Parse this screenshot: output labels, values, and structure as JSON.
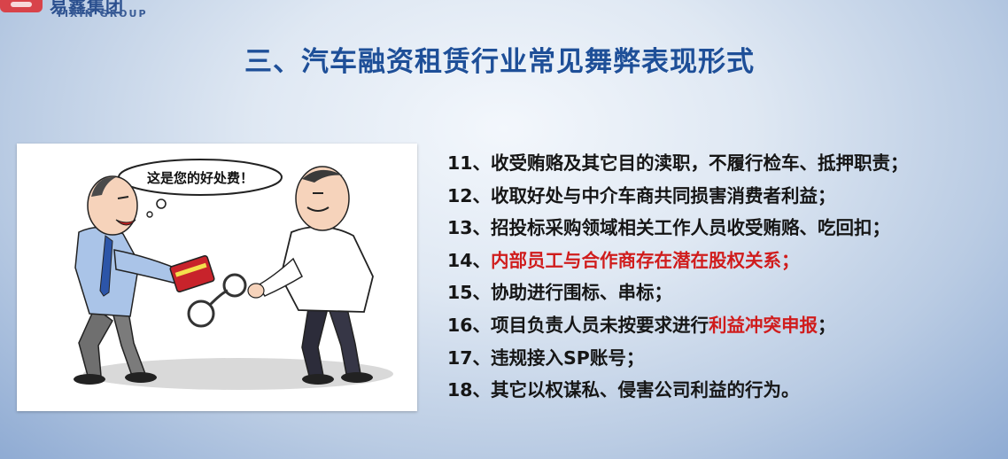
{
  "logo": {
    "cn": "易鑫集团",
    "en": "YIXIN GROUP"
  },
  "title": "三、汽车融资租赁行业常见舞弊表现形式",
  "cartoon": {
    "bubble": "这是您的好处费！"
  },
  "items": [
    {
      "num": "11、",
      "pre": "收受贿赂及其它目的渎职，不履行检车、抵押职责；",
      "hl": "",
      "post": ""
    },
    {
      "num": "12、",
      "pre": "收取好处与中介车商共同损害消费者利益；",
      "hl": "",
      "post": ""
    },
    {
      "num": "13、",
      "pre": "招投标采购领域相关工作人员收受贿赂、吃回扣；",
      "hl": "",
      "post": ""
    },
    {
      "num": "14、",
      "pre": "",
      "hl": "内部员工与合作商存在潜在股权关系；",
      "post": ""
    },
    {
      "num": "15、",
      "pre": "协助进行围标、串标；",
      "hl": "",
      "post": ""
    },
    {
      "num": "16、",
      "pre": "项目负责人员未按要求进行",
      "hl": "利益冲突申报",
      "post": "；"
    },
    {
      "num": "17、",
      "pre": "违规接入SP账号；",
      "hl": "",
      "post": ""
    },
    {
      "num": "18、",
      "pre": "其它以权谋私、侵害公司利益的行为。",
      "hl": "",
      "post": ""
    }
  ],
  "colors": {
    "title": "#1e4f98",
    "highlight": "#d01c1c",
    "logo_red": "#d8434a"
  }
}
